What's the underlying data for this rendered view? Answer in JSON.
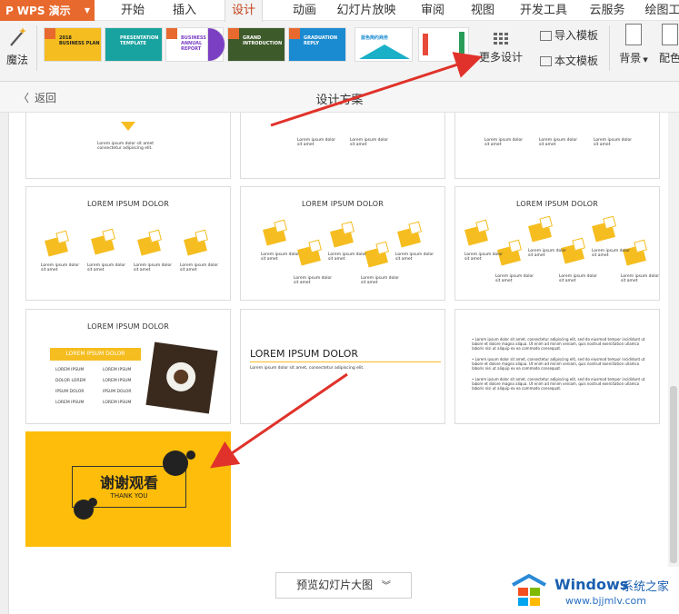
{
  "app": {
    "name": "WPS 演示",
    "logo": "P"
  },
  "tabs": [
    "开始",
    "插入",
    "设计",
    "动画",
    "幻灯片放映",
    "审阅",
    "视图",
    "开发工具",
    "云服务",
    "绘图工"
  ],
  "active_tab": "设计",
  "ribbon": {
    "magic_label": "魔法",
    "more_designs_label": "更多设计",
    "import_template_label": "导入模板",
    "text_template_label": "本文模板",
    "background_label": "背景",
    "color_label": "配色",
    "template_thumbs": [
      {
        "text": "2018\nBUSINESS PLAN",
        "color": "#f5bd1f"
      },
      {
        "text": "PRESENTATION\nTEMPLATE",
        "color": "#19a3a0"
      },
      {
        "text": "BUSINESS\nANNUAL REPORT",
        "color": "#ffffff"
      },
      {
        "text": "",
        "color": "#7b3fc4"
      },
      {
        "text": "GRAND\nINTRODUCTION",
        "color": "#3d5a2a"
      },
      {
        "text": "GRADUATION\nREPLY",
        "color": "#1a8ad1"
      },
      {
        "text": "蓝色简约商务",
        "color": "#ffffff"
      },
      {
        "text": "",
        "color": "#ffffff"
      }
    ]
  },
  "panel": {
    "back_label": "返回",
    "title": "设计方案",
    "preview_button": "预览幻灯片大图"
  },
  "slides": {
    "heading": "LOREM IPSUM DOLOR",
    "icon_label": "LOREM",
    "caption": "Lorem ipsum dolor sit amet",
    "caption_short": "Lorem ipsum dolor sit amet consectetur adipiscing elit.",
    "table_header": "LOREM IPSUM DOLOR",
    "table_cells": [
      "LOREM IPSUM",
      "LOREM IPSUM",
      "DOLOR LOREM",
      "LOREM IPSUM",
      "IPSUM DOLOR",
      "IPSUM DOLOR",
      "LOREM IPSUM",
      "LOREM IPSUM"
    ],
    "text_slide_title": "LOREM IPSUM DOLOR",
    "text_slide_sub": "Lorem ipsum dolor sit amet, consectetur adipiscing elit.",
    "bullets": [
      "Lorem ipsum dolor sit amet, consectetur adipiscing elit, sed do eiusmod tempor incididunt ut labore et dolore magna aliqua. Ut enim ad minim veniam, quis nostrud exercitation ullamco laboris nisi ut aliquip ex ea commodo consequat.",
      "Lorem ipsum dolor sit amet, consectetur adipiscing elit, sed do eiusmod tempor incididunt ut labore et dolore magna aliqua. Ut enim ad minim veniam, quis nostrud exercitation ullamco laboris nisi ut aliquip ex ea commodo consequat.",
      "Lorem ipsum dolor sit amet, consectetur adipiscing elit, sed do eiusmod tempor incididunt ut labore et dolore magna aliqua. Ut enim ad minim veniam, quis nostrud exercitation ullamco laboris nisi ut aliquip ex ea commodo consequat."
    ],
    "thanks_cn": "谢谢观看",
    "thanks_en": "THANK YOU"
  },
  "watermark": {
    "brand": "Windows",
    "cn": "系统之家",
    "url": "www.bjjmlv.com"
  },
  "colors": {
    "accent": "#e8692d",
    "yellow": "#f5bd1f",
    "arrow": "#e0322a"
  }
}
